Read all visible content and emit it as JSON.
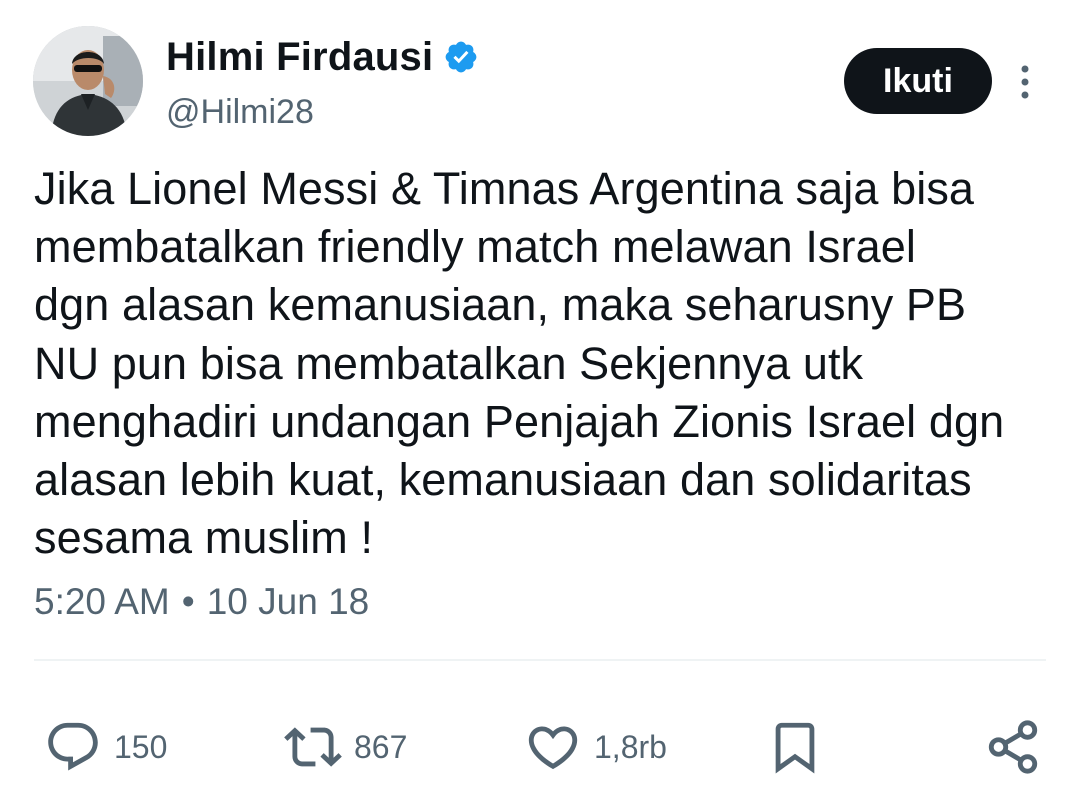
{
  "author": {
    "display_name": "Hilmi Firdausi",
    "handle": "@Hilmi28",
    "verified": true
  },
  "follow_button_label": "Ikuti",
  "tweet": {
    "text": "Jika Lionel Messi & Timnas Argentina saja bisa\nmembatalkan friendly match melawan Israel\ndgn alasan kemanusiaan, maka seharusny PB\nNU pun bisa membatalkan Sekjennya utk\nmenghadiri undangan Penjajah Zionis Israel dgn\nalasan lebih kuat, kemanusiaan dan solidaritas\nsesama muslim !",
    "time": "5:20 AM",
    "separator": "•",
    "date": "10 Jun 18"
  },
  "actions": {
    "reply_count": "150",
    "retweet_count": "867",
    "like_count": "1,8rb"
  },
  "icons": {
    "verified": "verified-badge-icon",
    "more": "more-vertical-icon",
    "reply": "reply-icon",
    "retweet": "retweet-icon",
    "like": "heart-icon",
    "bookmark": "bookmark-icon",
    "share": "share-icon"
  },
  "colors": {
    "text": "#0f1419",
    "secondary": "#536471",
    "verified": "#1d9bf0",
    "button_bg": "#0f1419",
    "button_text": "#ffffff",
    "divider": "#eff3f4"
  }
}
